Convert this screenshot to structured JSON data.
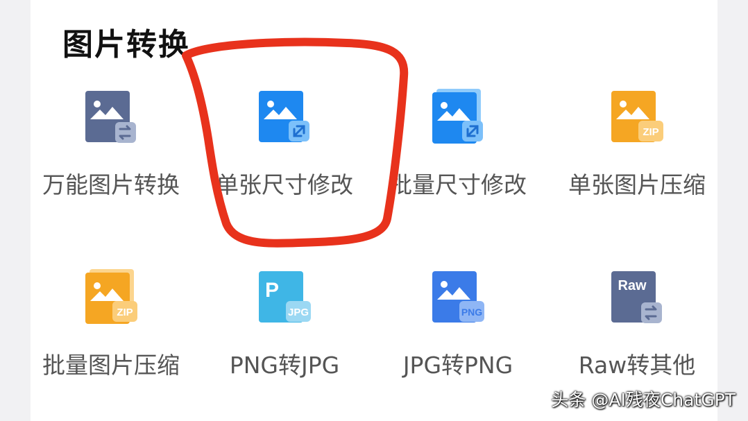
{
  "section": {
    "title": "图片转换"
  },
  "tools": [
    {
      "label": "万能图片转换",
      "icon": "image-convert-icon",
      "color": "#5b6b93"
    },
    {
      "label": "单张尺寸修改",
      "icon": "image-resize-icon",
      "color": "#1e88f0"
    },
    {
      "label": "批量尺寸修改",
      "icon": "batch-image-resize-icon",
      "color": "#1e88f0"
    },
    {
      "label": "单张图片压缩",
      "icon": "image-zip-icon",
      "color": "#f5a623",
      "badge": "ZIP"
    },
    {
      "label": "批量图片压缩",
      "icon": "batch-image-zip-icon",
      "color": "#f5a623",
      "badge": "ZIP"
    },
    {
      "label": "PNG转JPG",
      "icon": "png-to-jpg-icon",
      "color": "#3fb6e6",
      "letter": "P",
      "badge": "JPG"
    },
    {
      "label": "JPG转PNG",
      "icon": "jpg-to-png-icon",
      "color": "#3b7be8",
      "badge": "PNG"
    },
    {
      "label": "Raw转其他",
      "icon": "raw-convert-icon",
      "color": "#5b6b93",
      "letter": "Raw"
    }
  ],
  "annotation": {
    "color": "#e8321c"
  },
  "watermark": "头条 @AI残夜ChatGPT"
}
